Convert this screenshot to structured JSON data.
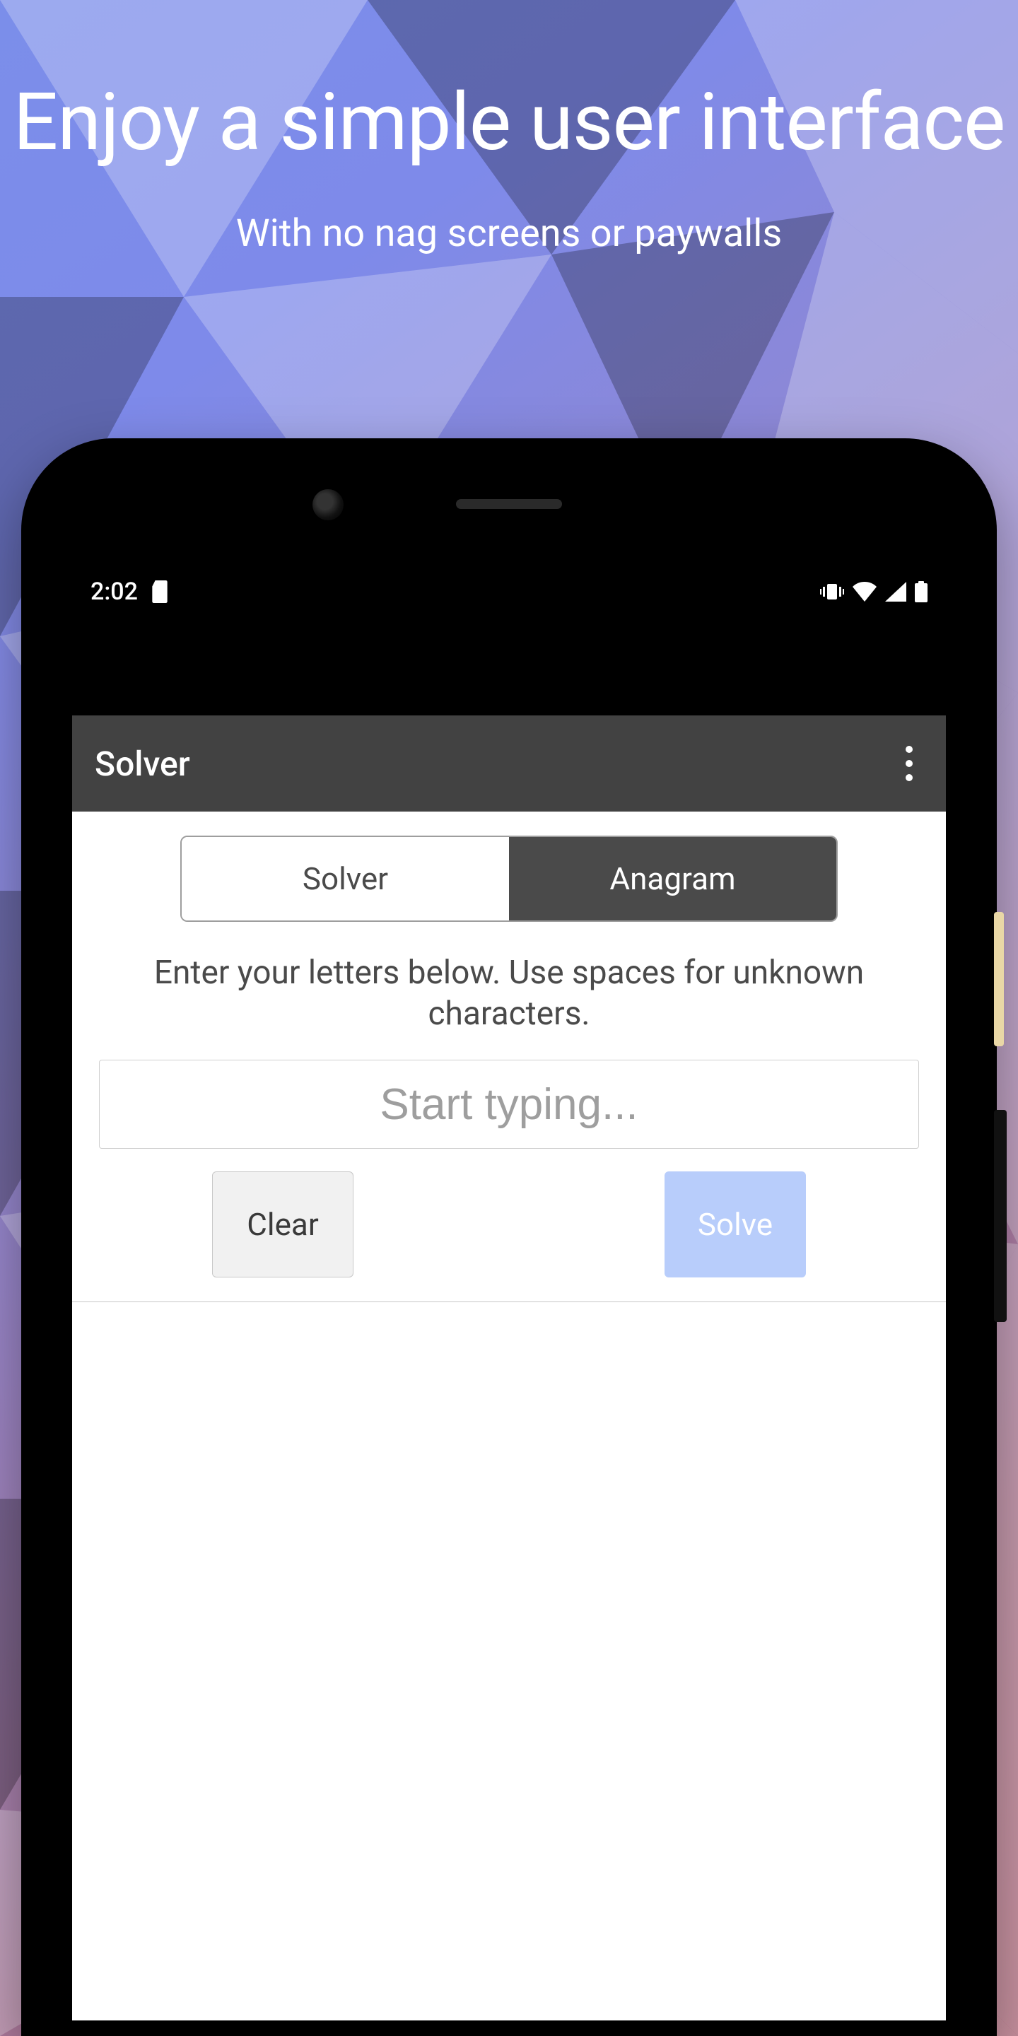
{
  "hero": {
    "title": "Enjoy a simple user interface",
    "subtitle": "With no nag screens or paywalls"
  },
  "statusbar": {
    "time": "2:02"
  },
  "appbar": {
    "title": "Solver"
  },
  "tabs": {
    "solver": "Solver",
    "anagram": "Anagram"
  },
  "hint": "Enter your letters below. Use spaces for unknown characters.",
  "input": {
    "placeholder": "Start typing..."
  },
  "buttons": {
    "clear": "Clear",
    "solve": "Solve"
  }
}
